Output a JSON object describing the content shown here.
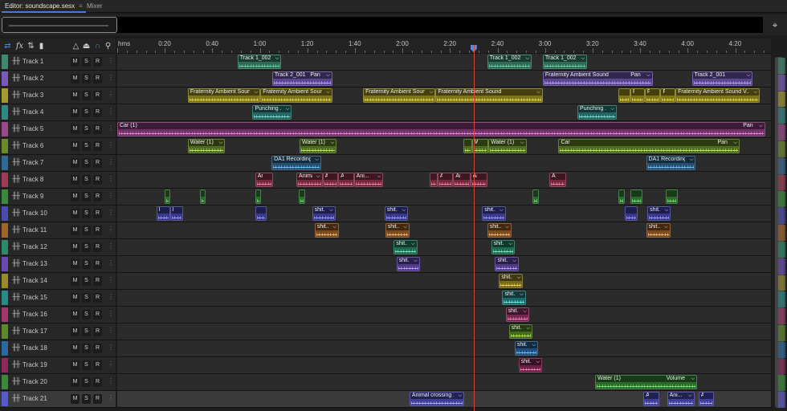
{
  "tabs": [
    {
      "label": "Editor: soundscape.sesx",
      "menu": "≡",
      "active": true
    },
    {
      "label": "Mixer",
      "active": false
    }
  ],
  "toolbar": {
    "icons": [
      "loop-icon",
      "fx-icon",
      "send-icon",
      "meter-icon",
      "metronome-icon",
      "snap-icon",
      "magnet-icon",
      "marker-pin-icon"
    ],
    "fx_label": "fx"
  },
  "ruler": {
    "unit": "hms",
    "labels": [
      "0:20",
      "0:40",
      "1:00",
      "1:20",
      "1:40",
      "2:00",
      "2:20",
      "2:40",
      "3:00",
      "3:20",
      "3:40",
      "4:00",
      "4:20"
    ],
    "playhead_time": "2:30"
  },
  "track_buttons": {
    "mute": "M",
    "solo": "S",
    "record": "R",
    "more": "⋮"
  },
  "tracks": [
    {
      "name": "Track 1",
      "color": "#3f8a6f",
      "clips": [
        {
          "label": "Track 1_002",
          "start": 0.184,
          "end": 0.251,
          "color": "#2e6b57",
          "wave": "#6fd9a8"
        },
        {
          "label": "Track 1_002",
          "start": 0.566,
          "end": 0.634,
          "color": "#2e6b57",
          "wave": "#6fd9a8"
        },
        {
          "label": "Track 1_002",
          "start": 0.651,
          "end": 0.719,
          "color": "#2e6b57",
          "wave": "#6fd9a8"
        }
      ]
    },
    {
      "name": "Track 2",
      "color": "#7a5ab8",
      "clips": [
        {
          "label": "Track 2_001",
          "pan": "Pan",
          "start": 0.237,
          "end": 0.329,
          "color": "#5b4690",
          "wave": "#c7a8ff"
        },
        {
          "label": "Fraternity Ambient Sound",
          "pan": "Pan",
          "start": 0.651,
          "end": 0.819,
          "color": "#5b4690",
          "wave": "#c7a8ff"
        },
        {
          "label": "Track 2_001",
          "pan": "",
          "start": 0.879,
          "end": 0.972,
          "color": "#5b4690",
          "wave": "#c7a8ff"
        }
      ]
    },
    {
      "name": "Track 3",
      "color": "#a89a2a",
      "clips": [
        {
          "label": "Fraternity Ambient Sound",
          "start": 0.108,
          "end": 0.219,
          "color": "#7e7418",
          "wave": "#f3e04a"
        },
        {
          "label": "Fraternity Ambient Sound",
          "start": 0.219,
          "end": 0.329,
          "color": "#7e7418",
          "wave": "#f3e04a"
        },
        {
          "label": "Fraternity Ambient Sound",
          "start": 0.376,
          "end": 0.487,
          "color": "#7e7418",
          "wave": "#f3e04a"
        },
        {
          "label": "Fraternity Ambient Sound",
          "start": 0.487,
          "end": 0.651,
          "color": "#7e7418",
          "wave": "#f3e04a"
        },
        {
          "label": "Fr...",
          "start": 0.766,
          "end": 0.785,
          "color": "#7e7418",
          "wave": "#f3e04a"
        },
        {
          "label": "Frat...",
          "start": 0.785,
          "end": 0.807,
          "color": "#7e7418",
          "wave": "#f3e04a"
        },
        {
          "label": "Fra...",
          "start": 0.807,
          "end": 0.831,
          "color": "#7e7418",
          "wave": "#f3e04a"
        },
        {
          "label": "Fra...",
          "start": 0.831,
          "end": 0.854,
          "color": "#7e7418",
          "wave": "#f3e04a"
        },
        {
          "label": "Fraternity Ambient Sound V...",
          "start": 0.854,
          "end": 0.983,
          "color": "#7e7418",
          "wave": "#f3e04a"
        }
      ]
    },
    {
      "name": "Track 4",
      "color": "#2f8a86",
      "clips": [
        {
          "label": "Punching ...",
          "start": 0.207,
          "end": 0.267,
          "color": "#246561",
          "wave": "#7fe8e0"
        },
        {
          "label": "Punching ...",
          "start": 0.704,
          "end": 0.764,
          "color": "#246561",
          "wave": "#7fe8e0"
        }
      ]
    },
    {
      "name": "Track 5",
      "color": "#9a4a8c",
      "clips": [
        {
          "label": "Car (1)",
          "pan": "Pan",
          "start": 0.0,
          "end": 0.991,
          "color": "#6e3266",
          "wave": "#ef8ae0"
        }
      ]
    },
    {
      "name": "Track 6",
      "color": "#6a8a2a",
      "clips": [
        {
          "label": "Water (1)",
          "start": 0.108,
          "end": 0.165,
          "color": "#4f6b1e",
          "wave": "#c3ef62"
        },
        {
          "label": "Water (1)",
          "start": 0.279,
          "end": 0.336,
          "color": "#4f6b1e",
          "wave": "#c3ef62"
        },
        {
          "label": "Wa",
          "start": 0.53,
          "end": 0.543,
          "color": "#4f6b1e",
          "wave": "#c3ef62"
        },
        {
          "label": "Water",
          "start": 0.543,
          "end": 0.568,
          "color": "#4f6b1e",
          "wave": "#c3ef62"
        },
        {
          "label": "Water (1)",
          "start": 0.568,
          "end": 0.626,
          "color": "#4f6b1e",
          "wave": "#c3ef62"
        },
        {
          "label": "Car",
          "pan": "Pan",
          "start": 0.675,
          "end": 0.952,
          "color": "#4f6b1e",
          "wave": "#c3ef62"
        }
      ]
    },
    {
      "name": "Track 7",
      "color": "#2f6a96",
      "clips": [
        {
          "label": "DA1 Recording 1",
          "start": 0.236,
          "end": 0.312,
          "color": "#244f70",
          "wave": "#7fc4ff"
        },
        {
          "label": "DA1 Recording 1",
          "start": 0.809,
          "end": 0.885,
          "color": "#244f70",
          "wave": "#7fc4ff"
        }
      ]
    },
    {
      "name": "Track 8",
      "color": "#a03a55",
      "clips": [
        {
          "label": "Ani...",
          "start": 0.211,
          "end": 0.238,
          "color": "#742a3e",
          "wave": "#ff8aa8"
        },
        {
          "label": "Animal c...",
          "start": 0.274,
          "end": 0.314,
          "color": "#742a3e",
          "wave": "#ff8aa8"
        },
        {
          "label": "Ani...",
          "start": 0.314,
          "end": 0.338,
          "color": "#742a3e",
          "wave": "#ff8aa8"
        },
        {
          "label": "Ani...",
          "start": 0.338,
          "end": 0.362,
          "color": "#742a3e",
          "wave": "#ff8aa8"
        },
        {
          "label": "Ani...",
          "start": 0.362,
          "end": 0.407,
          "color": "#742a3e",
          "wave": "#ff8aa8"
        },
        {
          "label": "A...",
          "start": 0.478,
          "end": 0.49,
          "color": "#742a3e",
          "wave": "#ff8aa8"
        },
        {
          "label": "Ani...",
          "start": 0.49,
          "end": 0.514,
          "color": "#742a3e",
          "wave": "#ff8aa8"
        },
        {
          "label": "Ani...",
          "start": 0.514,
          "end": 0.54,
          "color": "#742a3e",
          "wave": "#ff8aa8"
        },
        {
          "label": "Ani...",
          "start": 0.54,
          "end": 0.566,
          "color": "#742a3e",
          "wave": "#ff8aa8"
        },
        {
          "label": "Ani...",
          "start": 0.661,
          "end": 0.687,
          "color": "#742a3e",
          "wave": "#ff8aa8"
        }
      ]
    },
    {
      "name": "Track 9",
      "color": "#3a8a3a",
      "clips": [
        {
          "label": "",
          "start": 0.072,
          "end": 0.081,
          "color": "#2a6a2a",
          "wave": "#7fef7f"
        },
        {
          "label": "",
          "start": 0.126,
          "end": 0.135,
          "color": "#2a6a2a",
          "wave": "#7fef7f"
        },
        {
          "label": "",
          "start": 0.211,
          "end": 0.22,
          "color": "#2a6a2a",
          "wave": "#7fef7f"
        },
        {
          "label": "",
          "start": 0.278,
          "end": 0.287,
          "color": "#2a6a2a",
          "wave": "#7fef7f"
        },
        {
          "label": "",
          "start": 0.635,
          "end": 0.645,
          "color": "#2a6a2a",
          "wave": "#7fef7f"
        },
        {
          "label": "",
          "start": 0.767,
          "end": 0.776,
          "color": "#2a6a2a",
          "wave": "#7fef7f"
        },
        {
          "label": "bal...",
          "start": 0.785,
          "end": 0.804,
          "color": "#2a6a2a",
          "wave": "#7fef7f"
        },
        {
          "label": "bal...",
          "start": 0.839,
          "end": 0.858,
          "color": "#2a6a2a",
          "wave": "#7fef7f"
        }
      ]
    },
    {
      "name": "Track 10",
      "color": "#4a4ab0",
      "clips": [
        {
          "label": "bal...",
          "start": 0.06,
          "end": 0.081,
          "color": "#38388a",
          "wave": "#a8a8ff"
        },
        {
          "label": "bal...",
          "start": 0.081,
          "end": 0.101,
          "color": "#38388a",
          "wave": "#a8a8ff"
        },
        {
          "label": "bal...",
          "start": 0.211,
          "end": 0.229,
          "color": "#38388a",
          "wave": "#a8a8ff"
        },
        {
          "label": "shit...",
          "start": 0.298,
          "end": 0.334,
          "color": "#38388a",
          "wave": "#a8a8ff"
        },
        {
          "label": "shit...",
          "start": 0.409,
          "end": 0.445,
          "color": "#38388a",
          "wave": "#a8a8ff"
        },
        {
          "label": "shit...",
          "start": 0.558,
          "end": 0.594,
          "color": "#38388a",
          "wave": "#a8a8ff"
        },
        {
          "label": "bal...",
          "start": 0.777,
          "end": 0.796,
          "color": "#38388a",
          "wave": "#a8a8ff"
        },
        {
          "label": "shit...",
          "start": 0.811,
          "end": 0.847,
          "color": "#38388a",
          "wave": "#a8a8ff"
        }
      ]
    },
    {
      "name": "Track 11",
      "color": "#a0652a",
      "clips": [
        {
          "label": "shit...",
          "start": 0.302,
          "end": 0.339,
          "color": "#7a4a1c",
          "wave": "#ffc27f"
        },
        {
          "label": "shit...",
          "start": 0.41,
          "end": 0.447,
          "color": "#7a4a1c",
          "wave": "#ffc27f"
        },
        {
          "label": "shit...",
          "start": 0.566,
          "end": 0.603,
          "color": "#7a4a1c",
          "wave": "#ffc27f"
        },
        {
          "label": "shit...",
          "start": 0.809,
          "end": 0.846,
          "color": "#7a4a1c",
          "wave": "#ffc27f"
        }
      ]
    },
    {
      "name": "Track 12",
      "color": "#2a8a6a",
      "clips": [
        {
          "label": "shit...",
          "start": 0.423,
          "end": 0.459,
          "color": "#1e6a50",
          "wave": "#7fefc0"
        },
        {
          "label": "shit...",
          "start": 0.572,
          "end": 0.608,
          "color": "#1e6a50",
          "wave": "#7fefc0"
        }
      ]
    },
    {
      "name": "Track 13",
      "color": "#6a4ab0",
      "clips": [
        {
          "label": "shit...",
          "start": 0.427,
          "end": 0.463,
          "color": "#4e3888",
          "wave": "#c7a8ff"
        },
        {
          "label": "shit...",
          "start": 0.578,
          "end": 0.614,
          "color": "#4e3888",
          "wave": "#c7a8ff"
        }
      ]
    },
    {
      "name": "Track 14",
      "color": "#9a8a2a",
      "clips": [
        {
          "label": "shit...",
          "start": 0.584,
          "end": 0.621,
          "color": "#76681c",
          "wave": "#f3e04a"
        }
      ]
    },
    {
      "name": "Track 15",
      "color": "#2a8a8a",
      "clips": [
        {
          "label": "shit...",
          "start": 0.589,
          "end": 0.625,
          "color": "#1e6a6a",
          "wave": "#7fefef"
        }
      ]
    },
    {
      "name": "Track 16",
      "color": "#a03a6a",
      "clips": [
        {
          "label": "shit...",
          "start": 0.594,
          "end": 0.63,
          "color": "#742a50",
          "wave": "#ff8ac2"
        }
      ]
    },
    {
      "name": "Track 17",
      "color": "#5a8a2a",
      "clips": [
        {
          "label": "shit...",
          "start": 0.599,
          "end": 0.635,
          "color": "#446a1e",
          "wave": "#c3ef62"
        }
      ]
    },
    {
      "name": "Track 18",
      "color": "#2a6aa0",
      "clips": [
        {
          "label": "shit...",
          "start": 0.608,
          "end": 0.644,
          "color": "#1e4f7a",
          "wave": "#7fc4ff"
        }
      ]
    },
    {
      "name": "Track 19",
      "color": "#8a2a5a",
      "clips": [
        {
          "label": "shit...",
          "start": 0.614,
          "end": 0.65,
          "color": "#6a1e44",
          "wave": "#ff8ac2"
        }
      ]
    },
    {
      "name": "Track 20",
      "color": "#3a8a3a",
      "clips": [
        {
          "label": "Water (1)",
          "pan": "Volume",
          "start": 0.731,
          "end": 0.887,
          "color": "#2a6a2a",
          "wave": "#7fef7f"
        }
      ]
    },
    {
      "name": "Track 21",
      "color": "#5a5ad0",
      "selected": true,
      "clips": [
        {
          "label": "Animal crossing 2",
          "start": 0.447,
          "end": 0.531,
          "color": "#3e3e96",
          "wave": "#b8b8ff"
        },
        {
          "label": "Ani...",
          "start": 0.805,
          "end": 0.829,
          "color": "#3e3e96",
          "wave": "#b8b8ff"
        },
        {
          "label": "Ani...",
          "start": 0.841,
          "end": 0.883,
          "color": "#3e3e96",
          "wave": "#b8b8ff"
        },
        {
          "label": "Ani...",
          "start": 0.889,
          "end": 0.913,
          "color": "#3e3e96",
          "wave": "#b8b8ff"
        }
      ]
    }
  ]
}
